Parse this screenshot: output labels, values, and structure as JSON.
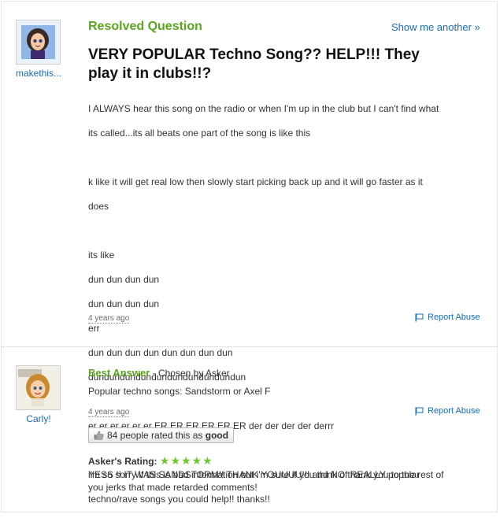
{
  "question": {
    "section_title": "Resolved Question",
    "show_another": "Show me another »",
    "title_line1": "VERY POPULAR Techno Song?? HELP!!! They",
    "title_line2": "play it in clubs!!?",
    "asker_name": "makethis...",
    "body": [
      "I ALWAYS hear this song on the radio or when I'm up in the club but I can't find what",
      "its called...its all beats one part of the song is like this",
      "",
      "k like it will get real low then slowly start picking back up and it will go faster as it",
      "does",
      "",
      "its like",
      "dun dun dun dun",
      "dun dun dun dun",
      "err",
      "dun dun dun dun dun dun dun dun",
      "dundundundundundundundundundun",
      "",
      "er er er er er er ER ER ER ER ER ER der der der der derrr",
      "",
      "i'm so sorry if this is bad information but i'm sure if you think of REALLY popular",
      "techno/rave songs you could help!! thanks!!"
    ],
    "timestamp": "4 years ago",
    "report_abuse": "Report Abuse"
  },
  "answer": {
    "heading": "Best Answer",
    "chosen_by": " - Chosen by Asker",
    "text": "Popular techno songs: Sandstorm or Axel F",
    "answerer_name": "Carly!",
    "timestamp": "4 years ago",
    "report_abuse": "Report Abuse",
    "rated_count": "84 people rated this as ",
    "rated_word": "good",
    "askers_rating_label": "Asker's Rating: ",
    "stars": "★★★★★",
    "star_count": 5,
    "comment_line1": "YESS !! IT WAS SANDSTORM!! THANK YOUUUU!!! and NO thank you to the rest of",
    "comment_line2": "you jerks that made retarded comments!"
  },
  "colors": {
    "green": "#5aa61e",
    "link": "#1a6bb5",
    "star": "#6ec72c"
  }
}
